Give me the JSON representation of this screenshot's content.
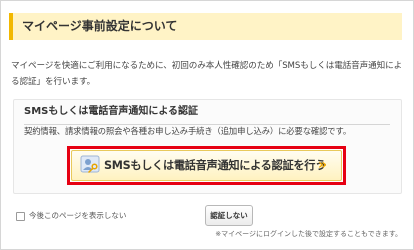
{
  "header": {
    "title": "マイページ事前設定について"
  },
  "intro": {
    "text": "マイページを快適にご利用になるために、初回のみ本人性確認のため「SMSもしくは電話音声通知による認証」を行います。"
  },
  "panel": {
    "title": "SMSもしくは電話音声通知による認証",
    "description": "契約情報、請求情報の照会や各種お申し込み手続き（追加申し込み）に必要な確認です。"
  },
  "auth_button": {
    "label": "SMSもしくは電話音声通知による認証を行う",
    "chevron": "»",
    "icon": "person-key-icon"
  },
  "hide_option": {
    "label": "今後このページを表示しない",
    "checked": false
  },
  "skip_button": {
    "label": "認証しない"
  },
  "note": {
    "text": "※マイページにログインした後で設定することもできます。"
  },
  "colors": {
    "accent": "#f2b800",
    "header_bg": "#fff3c6",
    "highlight": "#e60012"
  }
}
